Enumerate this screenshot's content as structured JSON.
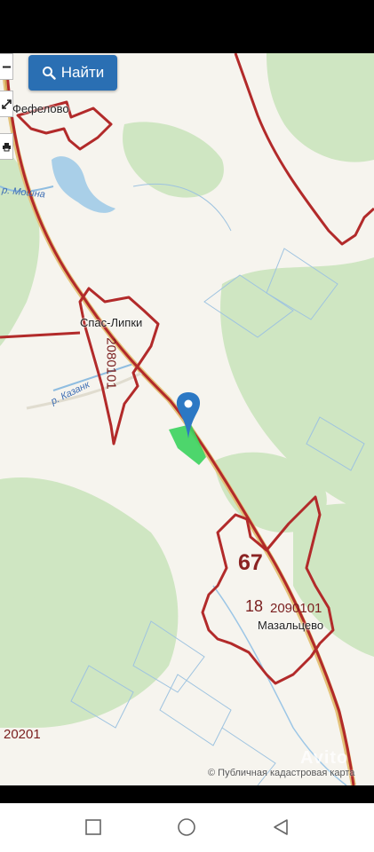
{
  "search": {
    "label": "Найти",
    "icon": "search-icon"
  },
  "toolbar": [
    {
      "name": "zoom-out-button",
      "icon": "minus-icon"
    },
    {
      "name": "fullscreen-button",
      "icon": "expand-icon"
    },
    {
      "name": "print-button",
      "icon": "printer-icon"
    }
  ],
  "map": {
    "settlements": {
      "fefelovo": "Фефелово",
      "spas_lipki": "Спас-Липки",
      "mazaltsevo": "Мазальцево"
    },
    "rivers": {
      "moshna": "р. Мошна",
      "kazanka": "р. Казанк"
    },
    "cadastral": {
      "district_67": "67",
      "block_18": "18",
      "quarter_2080101": "2080101",
      "quarter_2090101": "2090101",
      "quarter_20201": "20201"
    },
    "attribution": "© Публичная кадастровая карта",
    "watermark": "Avito",
    "colors": {
      "boundary": "#b22a2a",
      "road": "#c79a4a",
      "forest": "#cfe6c2",
      "water": "#a9cfe8",
      "parcel": "#3bd35d",
      "marker": "#2c78c4"
    }
  },
  "nav": {
    "recents_icon": "square-icon",
    "home_icon": "circle-icon",
    "back_icon": "triangle-back-icon"
  }
}
